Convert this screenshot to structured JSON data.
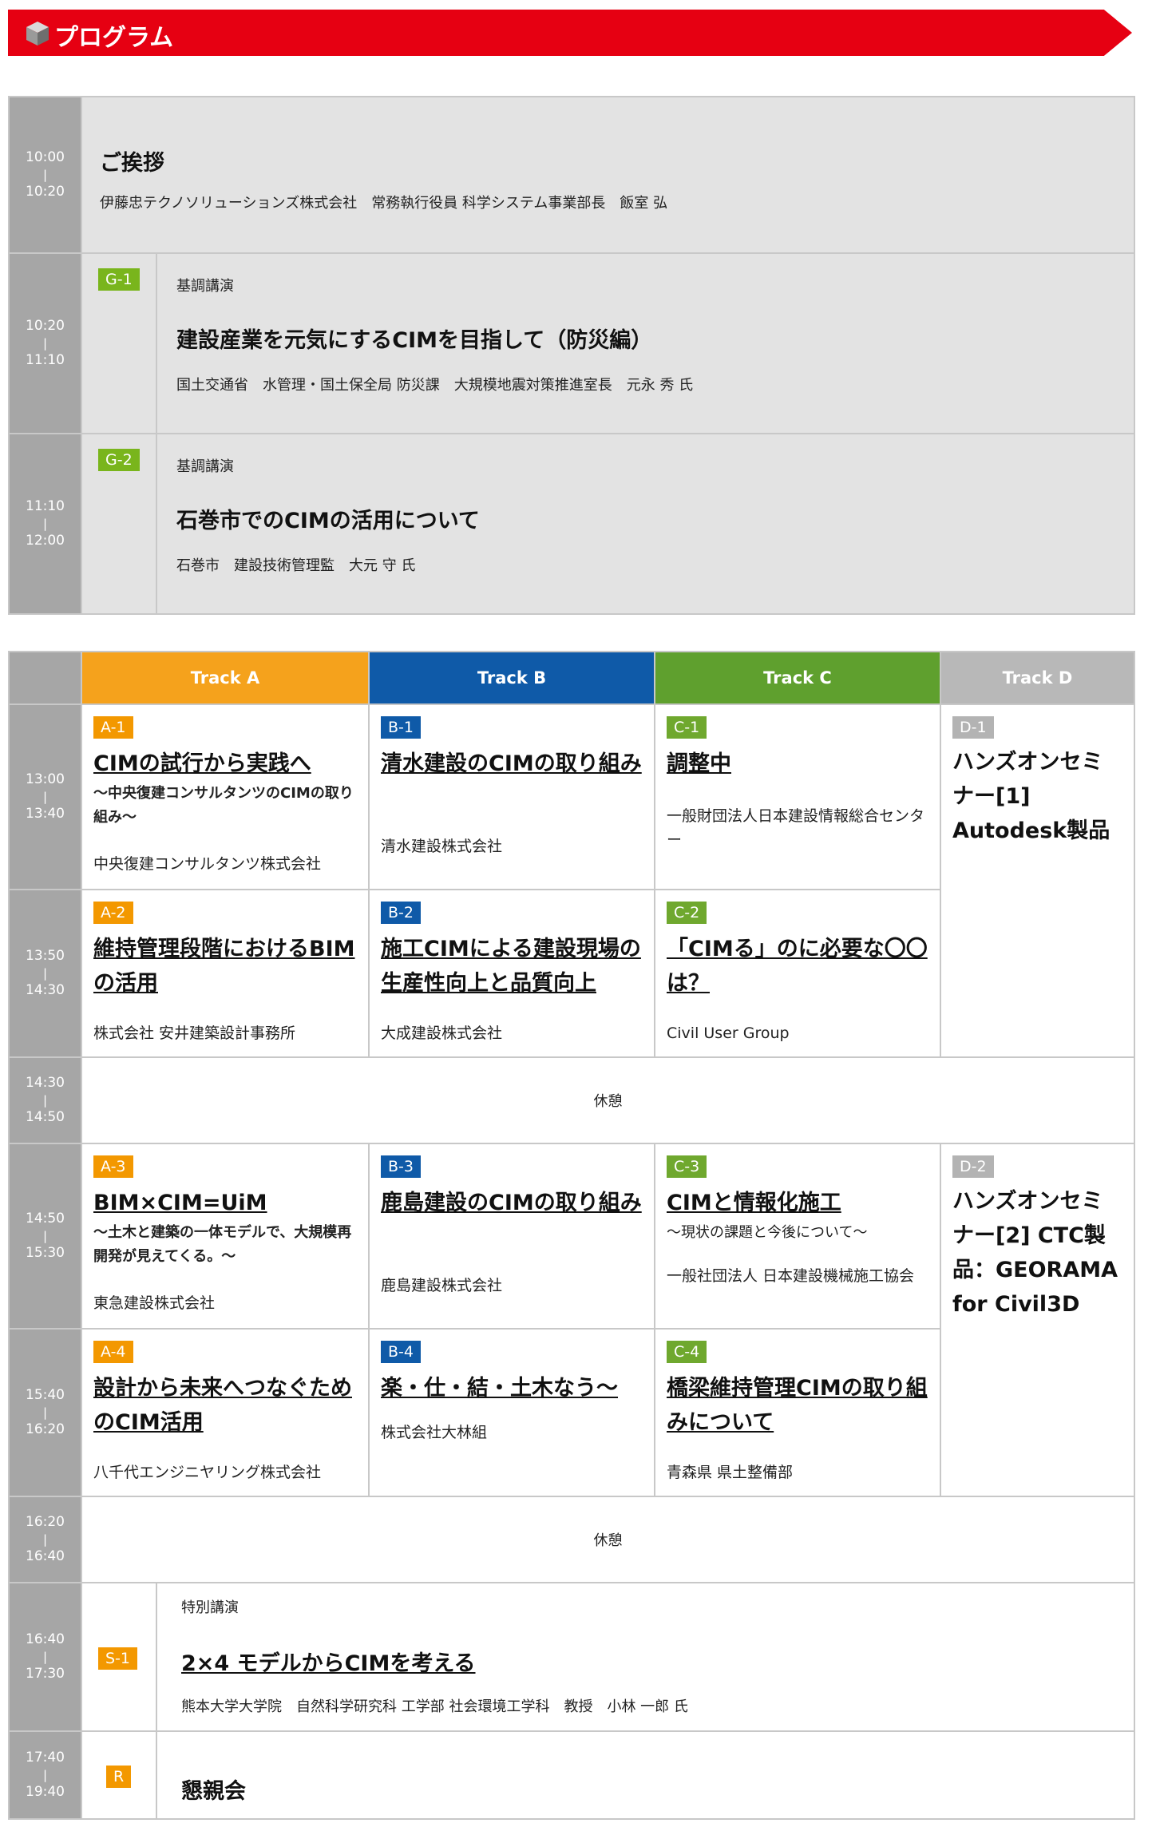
{
  "header": {
    "title": "プログラム"
  },
  "top": [
    {
      "start": "10:00",
      "end": "10:20",
      "title": "ご挨拶",
      "org": "伊藤忠テクノソリューションズ株式会社　常務執行役員 科学システム事業部長　飯室 弘"
    },
    {
      "start": "10:20",
      "end": "11:10",
      "badge": "G-1",
      "label": "基調講演",
      "title": "建設産業を元気にするCIMを目指して（防災編）",
      "org": "国土交通省　水管理・国土保全局 防災課　大規模地震対策推進室長　元永 秀 氏"
    },
    {
      "start": "11:10",
      "end": "12:00",
      "badge": "G-2",
      "label": "基調講演",
      "title": "石巻市でのCIMの活用について",
      "org": "石巻市　建設技術管理監　大元 守 氏"
    }
  ],
  "tracks": [
    "Track A",
    "Track B",
    "Track C",
    "Track D"
  ],
  "sessions": {
    "r1": {
      "start": "13:00",
      "end": "13:40",
      "a": {
        "badge": "A-1",
        "title": "CIMの試行から実践へ",
        "sub": "～中央復建コンサルタンツのCIMの取り組み～",
        "org": "中央復建コンサルタンツ株式会社"
      },
      "b": {
        "badge": "B-1",
        "title": "清水建設のCIMの取り組み",
        "org": "清水建設株式会社"
      },
      "c": {
        "badge": "C-1",
        "title": "調整中",
        "org": "一般財団法人日本建設情報総合センター"
      },
      "d": {
        "badge": "D-1",
        "title": "ハンズオンセミナー[1] Autodesk製品"
      }
    },
    "r2": {
      "start": "13:50",
      "end": "14:30",
      "a": {
        "badge": "A-2",
        "title": "維持管理段階におけるBIMの活用",
        "org": "株式会社 安井建築設計事務所"
      },
      "b": {
        "badge": "B-2",
        "title": "施工CIMによる建設現場の生産性向上と品質向上",
        "org": "大成建設株式会社"
      },
      "c": {
        "badge": "C-2",
        "title": "「CIMる」のに必要な〇〇は？",
        "org": "Civil User Group"
      }
    },
    "break1": {
      "start": "14:30",
      "end": "14:50",
      "label": "休憩"
    },
    "r3": {
      "start": "14:50",
      "end": "15:30",
      "a": {
        "badge": "A-3",
        "title": "BIM×CIM=UiM",
        "sub": "～土木と建築の一体モデルで、大規模再開発が見えてくる。～",
        "org": "東急建設株式会社"
      },
      "b": {
        "badge": "B-3",
        "title": "鹿島建設のCIMの取り組み",
        "org": "鹿島建設株式会社"
      },
      "c": {
        "badge": "C-3",
        "title": "CIMと情報化施工",
        "sub": "～現状の課題と今後について～",
        "org": "一般社団法人 日本建設機械施工協会"
      },
      "d": {
        "badge": "D-2",
        "title": "ハンズオンセミナー[2] CTC製品：GEORAMA for Civil3D"
      }
    },
    "r4": {
      "start": "15:40",
      "end": "16:20",
      "a": {
        "badge": "A-4",
        "title": "設計から未来へつなぐためのCIM活用",
        "org": "八千代エンジニヤリング株式会社"
      },
      "b": {
        "badge": "B-4",
        "title": "楽・仕・結・土木なう～",
        "org": "株式会社大林組"
      },
      "c": {
        "badge": "C-4",
        "title": "橋梁維持管理CIMの取り組みについて",
        "org": "青森県 県土整備部"
      }
    },
    "break2": {
      "start": "16:20",
      "end": "16:40",
      "label": "休憩"
    },
    "s1": {
      "start": "16:40",
      "end": "17:30",
      "badge": "S-1",
      "label": "特別講演",
      "title": "2×4 モデルからCIMを考える",
      "org": "熊本大学大学院　自然科学研究科 工学部 社会環境工学科　教授　小林 一郎 氏"
    },
    "party": {
      "start": "17:40",
      "end": "19:40",
      "badge": "R",
      "title": "懇親会"
    }
  },
  "colors": {
    "header": "#e60012",
    "trackA": "#f5a21c",
    "trackB": "#0f5aa8",
    "trackC": "#5fa02e",
    "trackD": "#b8b8b8",
    "timeCol": "#a6a6a6"
  }
}
